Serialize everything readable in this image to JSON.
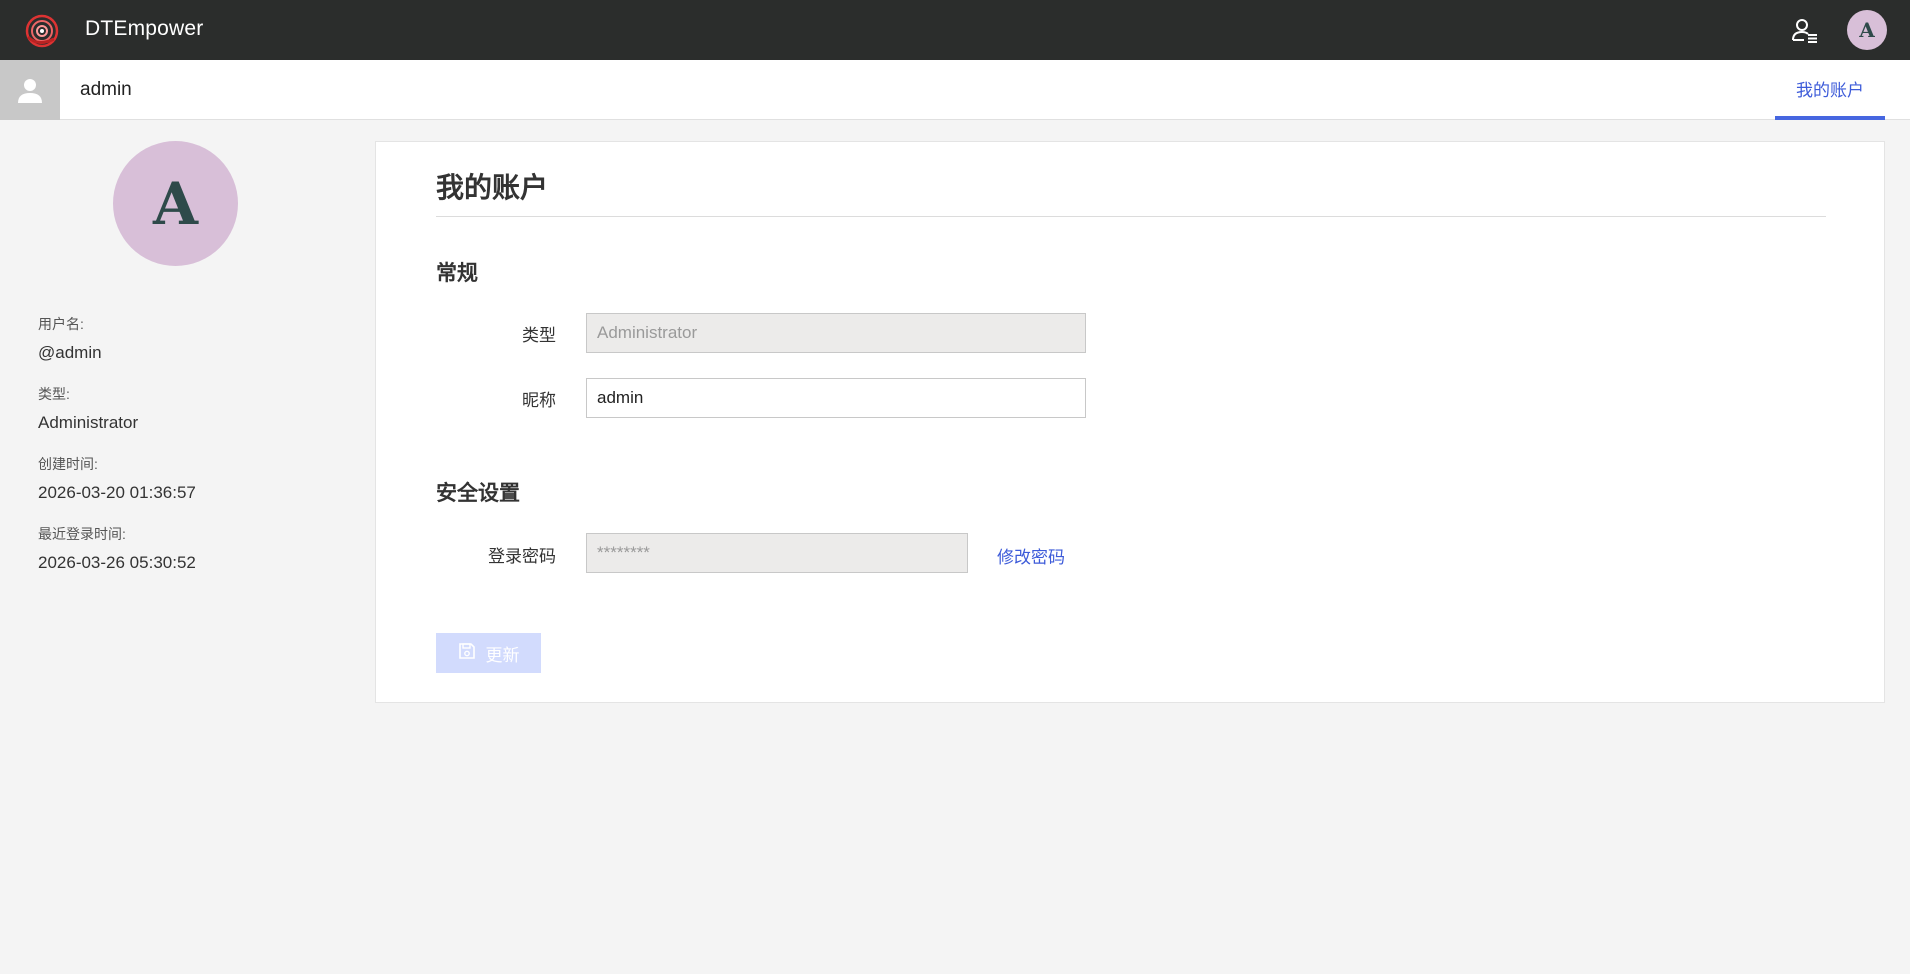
{
  "topbar": {
    "app_title": "DTEmpower",
    "avatar_letter": "A",
    "logo_icon": "dtempower-logo-icon",
    "user_menu_icon": "user-list-icon"
  },
  "subheader": {
    "username": "admin",
    "tab_label": "我的账户"
  },
  "profile": {
    "avatar_letter": "A",
    "avatar_color": "#d8bfd8",
    "fields": [
      {
        "label": "用户名:",
        "value": "@admin"
      },
      {
        "label": "类型:",
        "value": "Administrator"
      },
      {
        "label": "创建时间:",
        "value": "2026-03-20 01:36:57"
      },
      {
        "label": "最近登录时间:",
        "value": "2026-03-26 05:30:52"
      }
    ]
  },
  "card": {
    "title": "我的账户",
    "general": {
      "section_title": "常规",
      "type_label": "类型",
      "type_value": "Administrator",
      "nickname_label": "昵称",
      "nickname_value": "admin"
    },
    "security": {
      "section_title": "安全设置",
      "password_label": "登录密码",
      "password_value": "********",
      "change_password_link": "修改密码"
    },
    "update_button": "更新"
  },
  "colors": {
    "topbar_bg": "#2b2d2c",
    "accent": "#3d5bd9",
    "update_button_bg": "#d2dbfd"
  }
}
